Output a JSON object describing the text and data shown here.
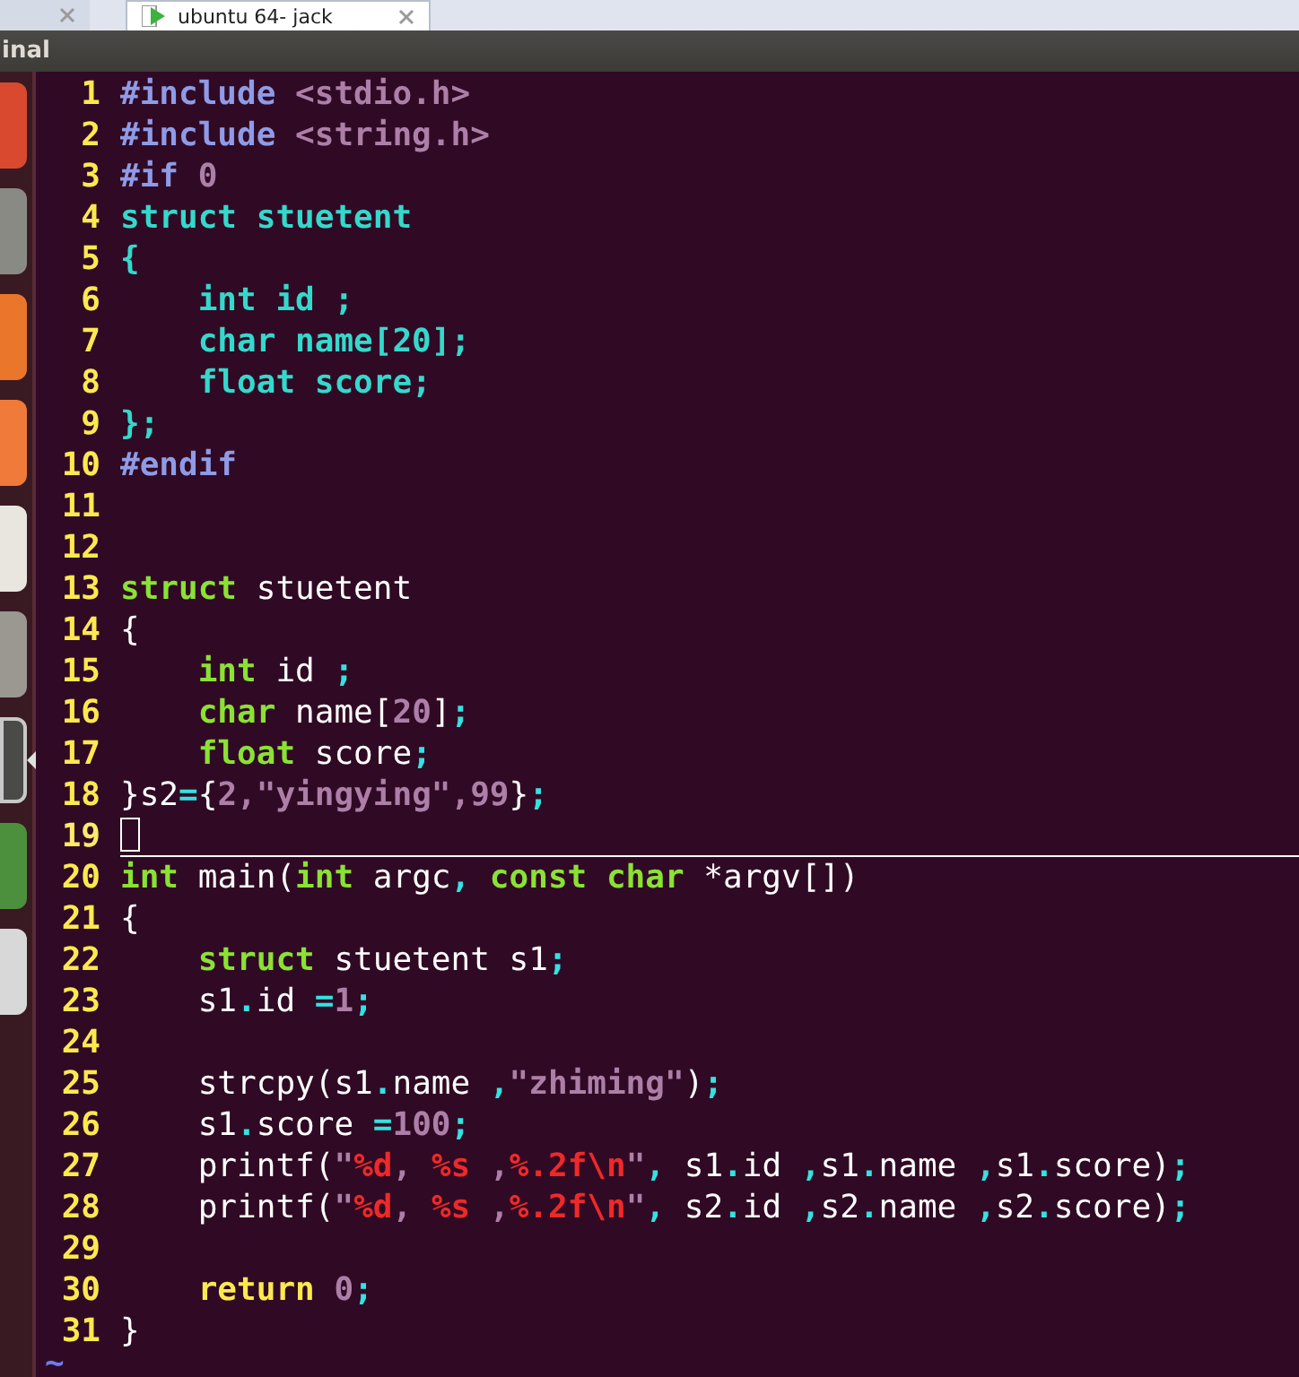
{
  "tabs": [
    {
      "selected": false
    },
    {
      "label": "ubuntu 64- jack",
      "selected": true
    }
  ],
  "window": {
    "title": "inal"
  },
  "launcher": [
    {
      "color": "#d9492f",
      "active": false
    },
    {
      "color": "#8a8a84",
      "active": false
    },
    {
      "color": "#e9762a",
      "active": false
    },
    {
      "color": "#f07a3a",
      "active": false
    },
    {
      "color": "#e8e6df",
      "active": false
    },
    {
      "color": "#9a9890",
      "active": false
    },
    {
      "color": "#4a4a48",
      "active": true
    },
    {
      "color": "#4c8f3c",
      "active": false
    },
    {
      "color": "#d8d8d8",
      "active": false
    }
  ],
  "editor": {
    "lines": [
      {
        "number": "1",
        "cursor": false,
        "tokens": [
          {
            "kind": "pre",
            "t": "#include"
          },
          {
            "kind": "inc",
            "t": " <stdio.h>"
          }
        ]
      },
      {
        "number": "2",
        "cursor": false,
        "tokens": [
          {
            "kind": "pre",
            "t": "#include"
          },
          {
            "kind": "inc",
            "t": " <string.h>"
          }
        ]
      },
      {
        "number": "3",
        "cursor": false,
        "tokens": [
          {
            "kind": "pre",
            "t": "#if"
          },
          {
            "kind": "inc",
            "t": " 0"
          }
        ]
      },
      {
        "number": "4",
        "cursor": false,
        "tokens": [
          {
            "kind": "com",
            "t": "struct stuetent"
          }
        ]
      },
      {
        "number": "5",
        "cursor": false,
        "tokens": [
          {
            "kind": "com",
            "t": "{"
          }
        ]
      },
      {
        "number": "6",
        "cursor": false,
        "tokens": [
          {
            "kind": "com",
            "t": "    int id ;"
          }
        ]
      },
      {
        "number": "7",
        "cursor": false,
        "tokens": [
          {
            "kind": "com",
            "t": "    char name[20];"
          }
        ]
      },
      {
        "number": "8",
        "cursor": false,
        "tokens": [
          {
            "kind": "com",
            "t": "    float score;"
          }
        ]
      },
      {
        "number": "9",
        "cursor": false,
        "tokens": [
          {
            "kind": "com",
            "t": "};"
          }
        ]
      },
      {
        "number": "10",
        "cursor": false,
        "tokens": [
          {
            "kind": "pre",
            "t": "#endif"
          }
        ]
      },
      {
        "number": "11",
        "cursor": false
      },
      {
        "number": "12",
        "cursor": false
      },
      {
        "number": "13",
        "cursor": false,
        "tokens": [
          {
            "kind": "type",
            "t": "struct"
          },
          {
            "kind": "plain",
            "t": " stuetent"
          }
        ]
      },
      {
        "number": "14",
        "cursor": false,
        "tokens": [
          {
            "kind": "plain",
            "t": "{"
          }
        ]
      },
      {
        "number": "15",
        "cursor": false,
        "tokens": [
          {
            "kind": "type",
            "t": "    int"
          },
          {
            "kind": "plain",
            "t": " id "
          },
          {
            "kind": "op",
            "t": ";"
          }
        ]
      },
      {
        "number": "16",
        "cursor": false,
        "tokens": [
          {
            "kind": "type",
            "t": "    char"
          },
          {
            "kind": "plain",
            "t": " name["
          },
          {
            "kind": "num",
            "t": "20"
          },
          {
            "kind": "plain",
            "t": "]"
          },
          {
            "kind": "op",
            "t": ";"
          }
        ]
      },
      {
        "number": "17",
        "cursor": false,
        "tokens": [
          {
            "kind": "type",
            "t": "    float"
          },
          {
            "kind": "plain",
            "t": " score"
          },
          {
            "kind": "op",
            "t": ";"
          }
        ]
      },
      {
        "number": "18",
        "cursor": false,
        "tokens": [
          {
            "kind": "plain",
            "t": "}s2"
          },
          {
            "kind": "op",
            "t": "="
          },
          {
            "kind": "plain",
            "t": "{"
          },
          {
            "kind": "num",
            "t": "2,\"yingying\",99"
          },
          {
            "kind": "plain",
            "t": "}"
          },
          {
            "kind": "op",
            "t": ";"
          }
        ]
      },
      {
        "number": "19",
        "cursor": true
      },
      {
        "number": "20",
        "cursor": false,
        "tokens": [
          {
            "kind": "type",
            "t": "int"
          },
          {
            "kind": "plain",
            "t": " main("
          },
          {
            "kind": "type",
            "t": "int"
          },
          {
            "kind": "plain",
            "t": " argc"
          },
          {
            "kind": "op",
            "t": ","
          },
          {
            "kind": "type",
            "t": " const"
          },
          {
            "kind": "type",
            "t": " char"
          },
          {
            "kind": "plain",
            "t": " *argv[])"
          }
        ]
      },
      {
        "number": "21",
        "cursor": false,
        "tokens": [
          {
            "kind": "plain",
            "t": "{"
          }
        ]
      },
      {
        "number": "22",
        "cursor": false,
        "tokens": [
          {
            "kind": "type",
            "t": "    struct"
          },
          {
            "kind": "plain",
            "t": " stuetent s1"
          },
          {
            "kind": "op",
            "t": ";"
          }
        ]
      },
      {
        "number": "23",
        "cursor": false,
        "tokens": [
          {
            "kind": "plain",
            "t": "    s1"
          },
          {
            "kind": "op",
            "t": "."
          },
          {
            "kind": "plain",
            "t": "id "
          },
          {
            "kind": "op",
            "t": "="
          },
          {
            "kind": "num",
            "t": "1"
          },
          {
            "kind": "op",
            "t": ";"
          }
        ]
      },
      {
        "number": "24",
        "cursor": false
      },
      {
        "number": "25",
        "cursor": false,
        "tokens": [
          {
            "kind": "plain",
            "t": "    strcpy(s1"
          },
          {
            "kind": "op",
            "t": "."
          },
          {
            "kind": "plain",
            "t": "name "
          },
          {
            "kind": "op",
            "t": ","
          },
          {
            "kind": "num",
            "t": "\"zhiming\""
          },
          {
            "kind": "plain",
            "t": ")"
          },
          {
            "kind": "op",
            "t": ";"
          }
        ]
      },
      {
        "number": "26",
        "cursor": false,
        "tokens": [
          {
            "kind": "plain",
            "t": "    s1"
          },
          {
            "kind": "op",
            "t": "."
          },
          {
            "kind": "plain",
            "t": "score "
          },
          {
            "kind": "op",
            "t": "="
          },
          {
            "kind": "num",
            "t": "100"
          },
          {
            "kind": "op",
            "t": ";"
          }
        ]
      },
      {
        "number": "27",
        "cursor": false,
        "tokens": [
          {
            "kind": "plain",
            "t": "    printf("
          },
          {
            "kind": "num",
            "t": "\""
          },
          {
            "kind": "fmt",
            "t": "%d"
          },
          {
            "kind": "num",
            "t": ", "
          },
          {
            "kind": "fmt",
            "t": "%s"
          },
          {
            "kind": "num",
            "t": " ,"
          },
          {
            "kind": "fmt",
            "t": "%.2f\\n"
          },
          {
            "kind": "num",
            "t": "\""
          },
          {
            "kind": "op",
            "t": ","
          },
          {
            "kind": "plain",
            "t": " s1"
          },
          {
            "kind": "op",
            "t": "."
          },
          {
            "kind": "plain",
            "t": "id "
          },
          {
            "kind": "op",
            "t": ","
          },
          {
            "kind": "plain",
            "t": "s1"
          },
          {
            "kind": "op",
            "t": "."
          },
          {
            "kind": "plain",
            "t": "name "
          },
          {
            "kind": "op",
            "t": ","
          },
          {
            "kind": "plain",
            "t": "s1"
          },
          {
            "kind": "op",
            "t": "."
          },
          {
            "kind": "plain",
            "t": "score)"
          },
          {
            "kind": "op",
            "t": ";"
          }
        ]
      },
      {
        "number": "28",
        "cursor": false,
        "tokens": [
          {
            "kind": "plain",
            "t": "    printf("
          },
          {
            "kind": "num",
            "t": "\""
          },
          {
            "kind": "fmt",
            "t": "%d"
          },
          {
            "kind": "num",
            "t": ", "
          },
          {
            "kind": "fmt",
            "t": "%s"
          },
          {
            "kind": "num",
            "t": " ,"
          },
          {
            "kind": "fmt",
            "t": "%.2f\\n"
          },
          {
            "kind": "num",
            "t": "\""
          },
          {
            "kind": "op",
            "t": ","
          },
          {
            "kind": "plain",
            "t": " s2"
          },
          {
            "kind": "op",
            "t": "."
          },
          {
            "kind": "plain",
            "t": "id "
          },
          {
            "kind": "op",
            "t": ","
          },
          {
            "kind": "plain",
            "t": "s2"
          },
          {
            "kind": "op",
            "t": "."
          },
          {
            "kind": "plain",
            "t": "name "
          },
          {
            "kind": "op",
            "t": ","
          },
          {
            "kind": "plain",
            "t": "s2"
          },
          {
            "kind": "op",
            "t": "."
          },
          {
            "kind": "plain",
            "t": "score)"
          },
          {
            "kind": "op",
            "t": ";"
          }
        ]
      },
      {
        "number": "29",
        "cursor": false
      },
      {
        "number": "30",
        "cursor": false,
        "tokens": [
          {
            "kind": "stmt",
            "t": "    return"
          },
          {
            "kind": "num",
            "t": " 0"
          },
          {
            "kind": "op",
            "t": ";"
          }
        ]
      },
      {
        "number": "31",
        "cursor": false,
        "tokens": [
          {
            "kind": "plain",
            "t": "}"
          }
        ]
      }
    ],
    "filler": "~"
  }
}
